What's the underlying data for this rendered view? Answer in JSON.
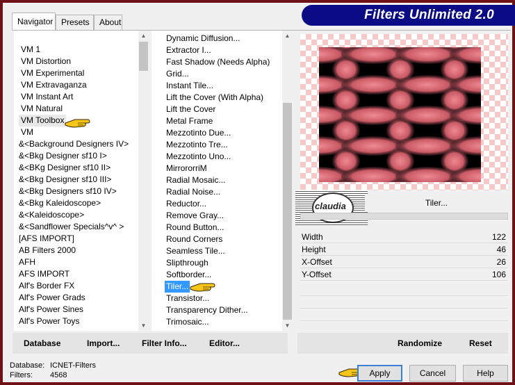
{
  "title": "Filters Unlimited 2.0",
  "tabs": [
    "Navigator",
    "Presets",
    "About"
  ],
  "categories": [
    "VM 1",
    "VM Distortion",
    "VM Experimental",
    "VM Extravaganza",
    "VM Instant Art",
    "VM Natural",
    "VM Toolbox",
    "VM",
    "&<Background Designers IV>",
    "&<Bkg Designer sf10 I>",
    "&<BKg Designer sf10 II>",
    "&<Bkg Designer sf10 III>",
    "&<Bkg Designers sf10 IV>",
    "&<Bkg Kaleidoscope>",
    "&<Kaleidoscope>",
    "&<Sandflower Specials^v^ >",
    "[AFS IMPORT]",
    "AB Filters 2000",
    "AFH",
    "AFS IMPORT",
    "Alf's Border FX",
    "Alf's Power Grads",
    "Alf's Power Sines",
    "Alf's Power Toys"
  ],
  "selected_category": "VM Toolbox",
  "filters": [
    "Dynamic Diffusion...",
    "Extractor I...",
    "Fast Shadow (Needs Alpha)",
    "Grid...",
    "Instant Tile...",
    "Lift the Cover (With Alpha)",
    "Lift the Cover",
    "Metal Frame",
    "Mezzotinto Due...",
    "Mezzotinto Tre...",
    "Mezzotinto Uno...",
    "MirrororriM",
    "Radial Mosaic...",
    "Radial Noise...",
    "Reductor...",
    "Remove Gray...",
    "Round Button...",
    "Round Corners",
    "Seamless Tile...",
    "Slipthrough",
    "Softborder...",
    "Tiler...",
    "Transistor...",
    "Transparency Dither...",
    "Trimosaic..."
  ],
  "selected_filter": "Tiler...",
  "filter_name": "Tiler...",
  "watermark_text": "claudia",
  "params": [
    {
      "label": "Width",
      "value": "122"
    },
    {
      "label": "Height",
      "value": "46"
    },
    {
      "label": "X-Offset",
      "value": "26"
    },
    {
      "label": "Y-Offset",
      "value": "106"
    }
  ],
  "left_buttons": {
    "database": "Database",
    "import": "Import...",
    "filter_info": "Filter Info...",
    "editor": "Editor..."
  },
  "right_buttons": {
    "randomize": "Randomize",
    "reset": "Reset"
  },
  "status": {
    "database_label": "Database:",
    "database_value": "ICNET-Filters",
    "filters_label": "Filters:",
    "filters_value": "4568"
  },
  "dialog_buttons": {
    "apply": "Apply",
    "cancel": "Cancel",
    "help": "Help"
  },
  "colors": {
    "frame": "#6e1218",
    "title_bar": "#0b0b86",
    "selection": "#3399ff",
    "preview_pink": "#e0707a",
    "hand": "#f5c518"
  }
}
